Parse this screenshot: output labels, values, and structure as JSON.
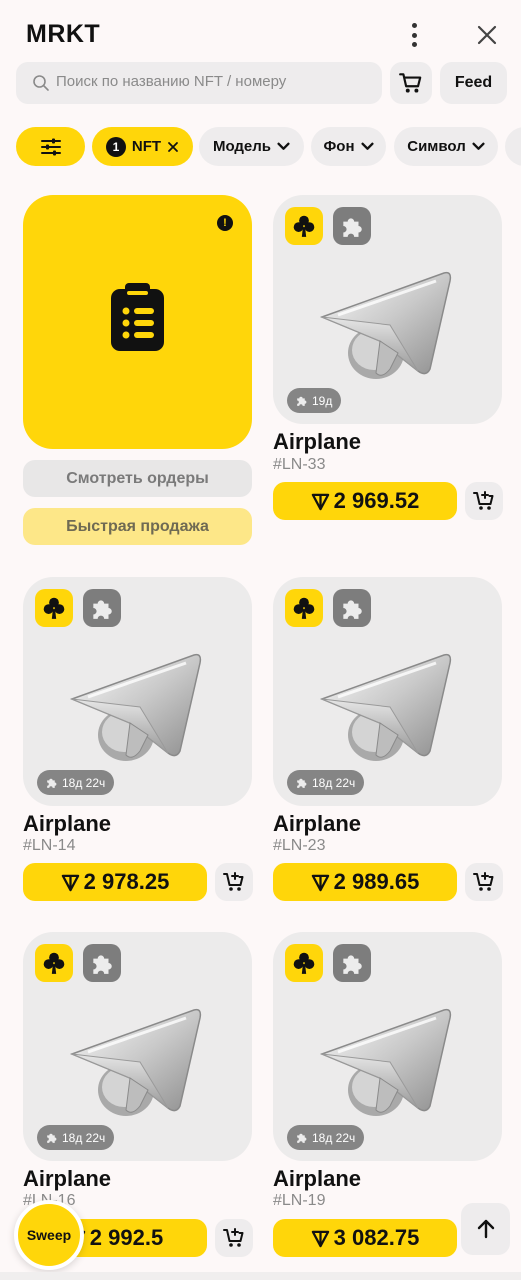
{
  "header": {
    "title": "MRKT"
  },
  "search": {
    "placeholder": "Поиск по названию NFT / номеру",
    "feed_label": "Feed"
  },
  "filters": {
    "nft_count": "1",
    "nft_label": "NFT",
    "model_label": "Модель",
    "background_label": "Фон",
    "symbol_label": "Символ"
  },
  "orders_card": {
    "view_orders_label": "Смотреть ордеры",
    "quick_sell_label": "Быстрая продажа"
  },
  "items": [
    {
      "name": "Airplane",
      "number": "#LN-33",
      "price": "2 969.52",
      "time": "19д"
    },
    {
      "name": "Airplane",
      "number": "#LN-14",
      "price": "2 978.25",
      "time": "18д 22ч"
    },
    {
      "name": "Airplane",
      "number": "#LN-23",
      "price": "2 989.65",
      "time": "18д 22ч"
    },
    {
      "name": "Airplane",
      "number": "#LN-16",
      "price": "2 992.5",
      "time": "18д 22ч"
    },
    {
      "name": "Airplane",
      "number": "#LN-19",
      "price": "3 082.75",
      "time": "18д 22ч"
    }
  ],
  "sweep_label": "Sweep",
  "colors": {
    "accent": "#ffd60a",
    "card": "#ecebeb",
    "background": "#fdf8f8"
  },
  "icons": {
    "symbol": "clover-icon",
    "backdrop": "puzzle-icon",
    "currency": "ton-icon"
  }
}
